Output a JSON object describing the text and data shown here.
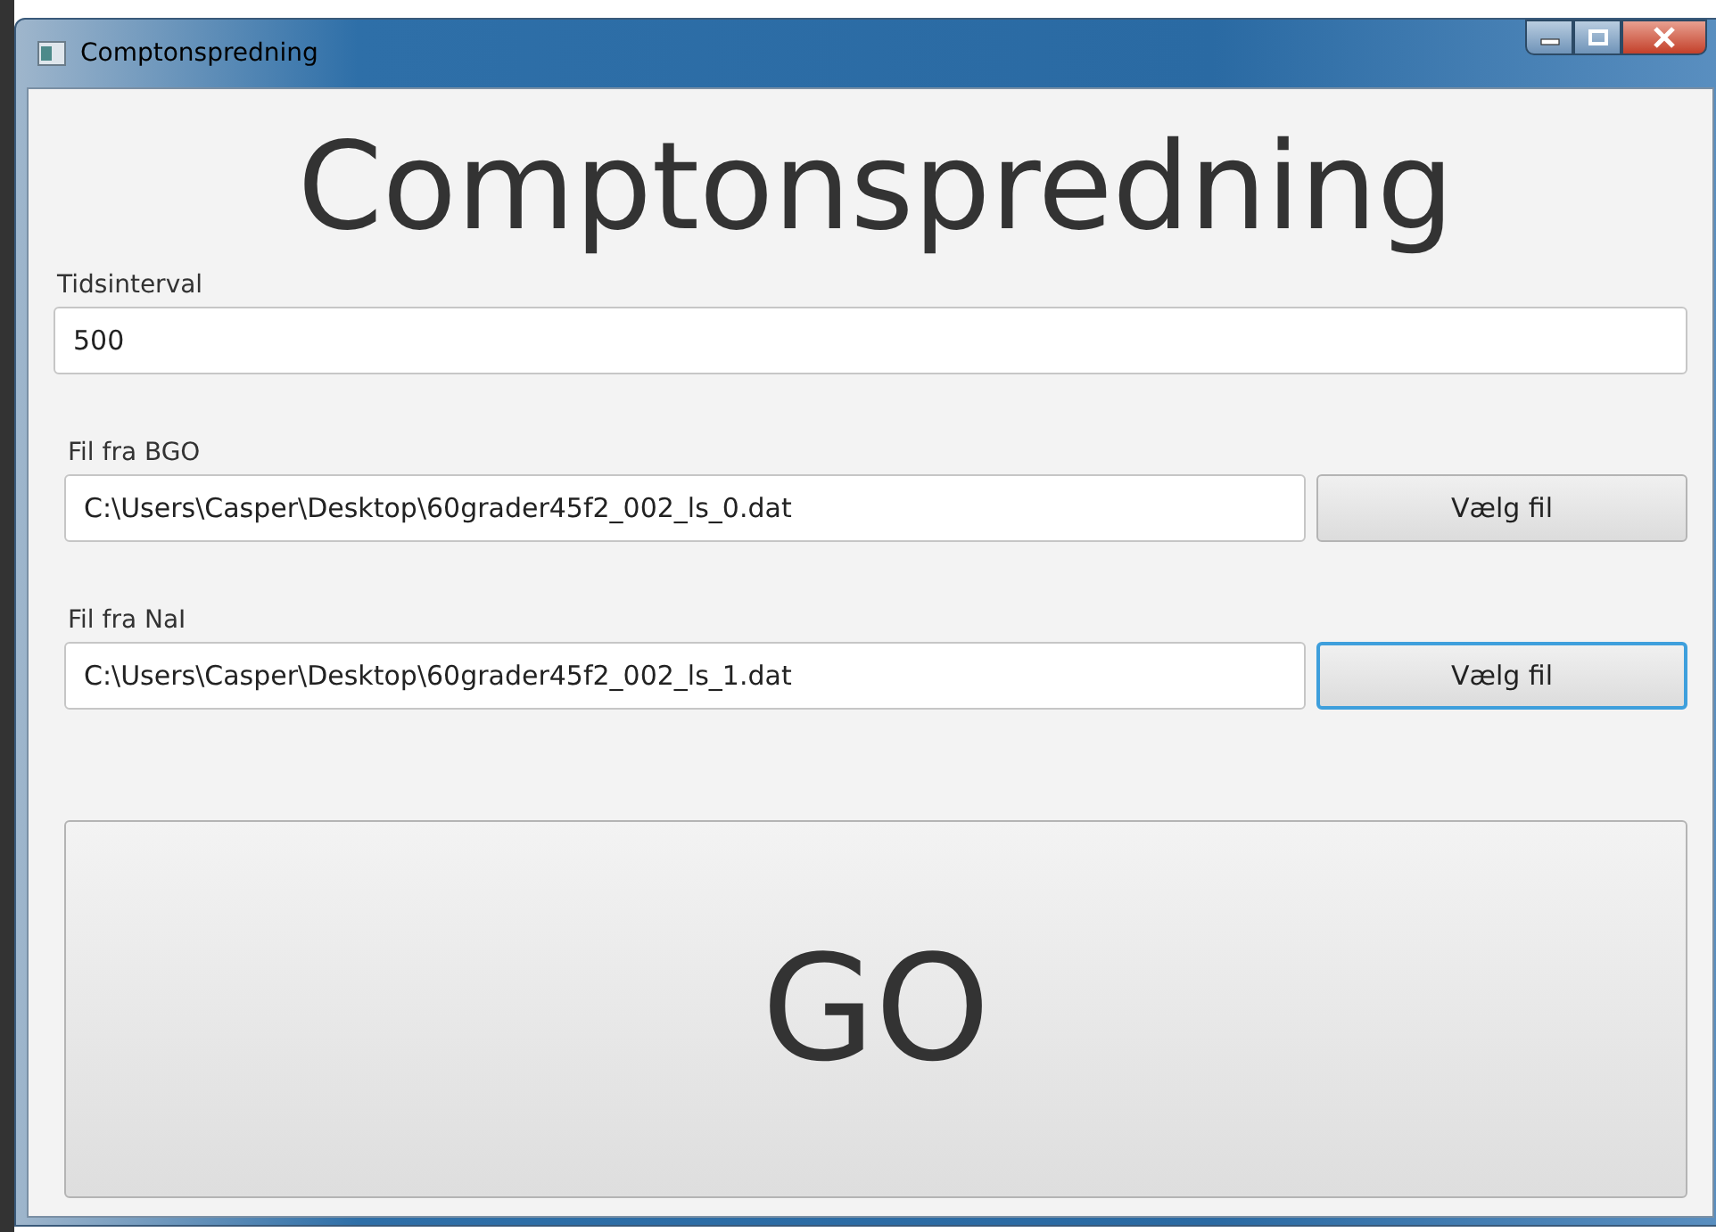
{
  "window": {
    "title": "Comptonspredning"
  },
  "heading": "Comptonspredning",
  "fields": [
    {
      "label": "Tidsinterval",
      "value": "500"
    },
    {
      "label": "Fil fra BGO",
      "value": "C:\\Users\\Casper\\Desktop\\60grader45f2_002_ls_0.dat",
      "button": {
        "label": "Vælg fil",
        "focused": false
      }
    },
    {
      "label": "Fil fra NaI",
      "value": "C:\\Users\\Casper\\Desktop\\60grader45f2_002_ls_1.dat",
      "button": {
        "label": "Vælg fil",
        "focused": true
      }
    }
  ],
  "go_button": {
    "label": "GO"
  }
}
